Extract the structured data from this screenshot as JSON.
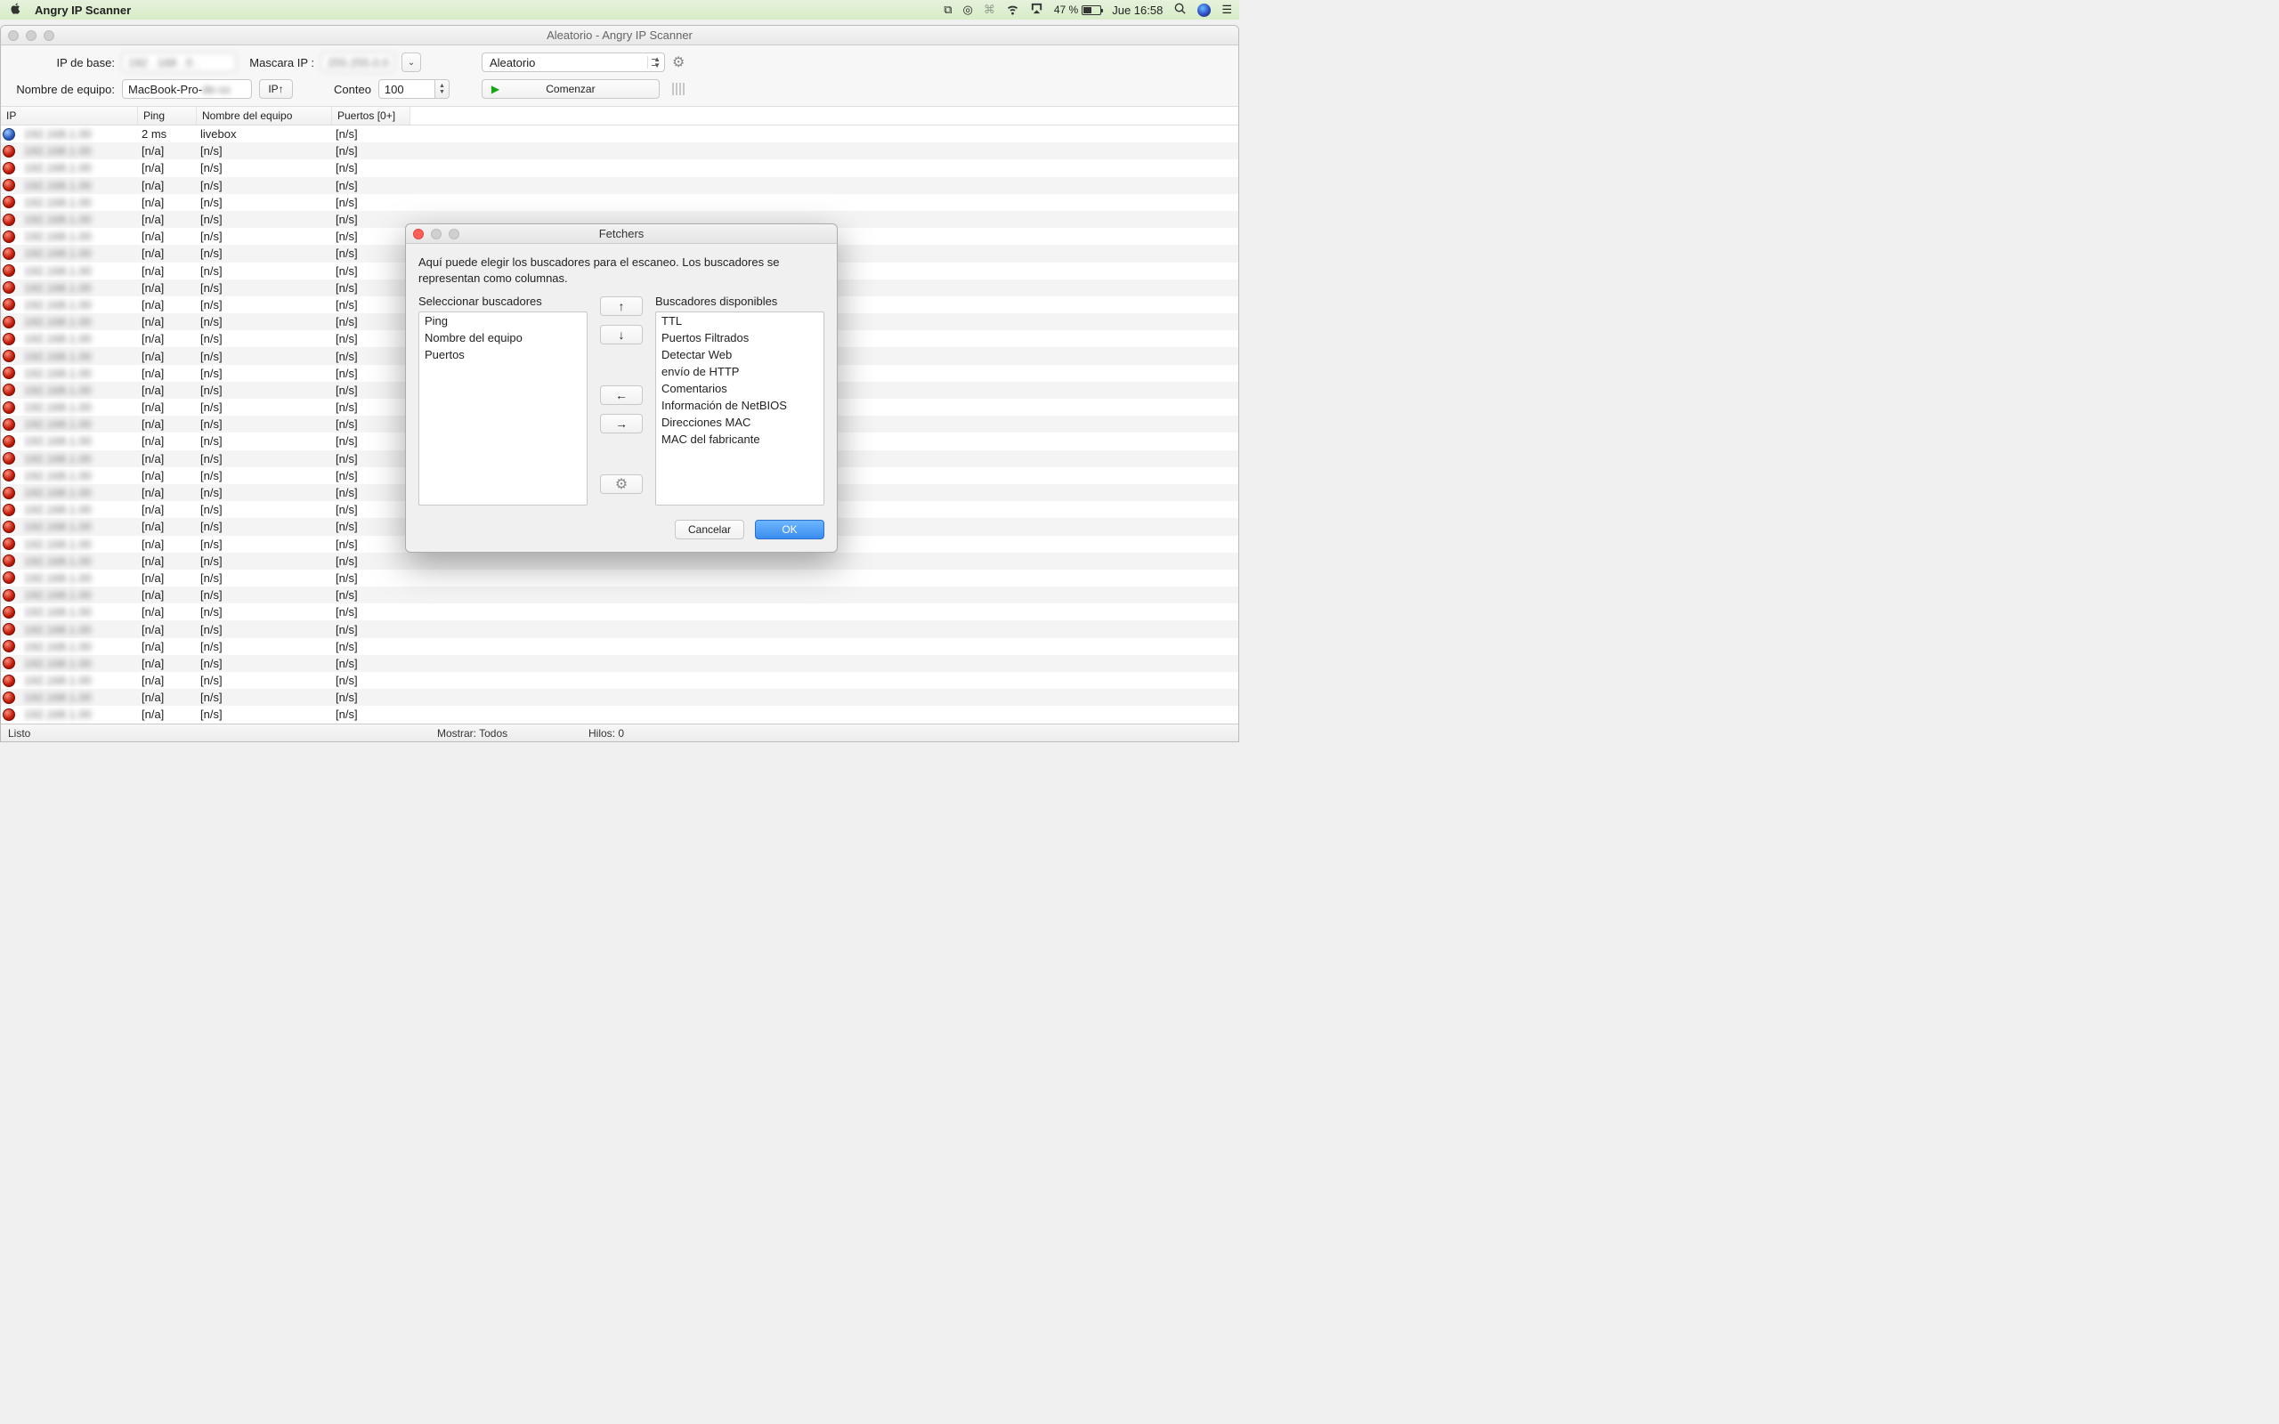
{
  "menubar": {
    "app_name": "Angry IP Scanner",
    "battery_pct": "47 %",
    "clock": "Jue 16:58"
  },
  "window": {
    "title": "Aleatorio - Angry IP Scanner"
  },
  "toolbar": {
    "ip_base_label": "IP de base:",
    "ip_base_value": "192 . 168 .    0 .",
    "mask_label": "Mascara IP :",
    "mask_value": "255.255.0.0",
    "mask_dropdown": "",
    "mode_value": "Aleatorio",
    "hostname_label": "Nombre de equipo:",
    "hostname_value": "MacBook-Pro-",
    "ip_up_btn": "IP↑",
    "count_label": "Conteo",
    "count_value": "100",
    "start_btn": "Comenzar"
  },
  "columns": {
    "ip": "IP",
    "ping": "Ping",
    "host": "Nombre del equipo",
    "ports": "Puertos [0+]"
  },
  "first_row": {
    "ping": "2 ms",
    "host": "livebox",
    "ports": "[n/s]"
  },
  "na": "[n/a]",
  "ns": "[n/s]",
  "dead_row_count": 35,
  "statusbar": {
    "ready": "Listo",
    "show": "Mostrar: Todos",
    "threads": "Hilos: 0"
  },
  "dialog": {
    "title": "Fetchers",
    "desc": "Aquí puede elegir los buscadores para el escaneo. Los buscadores se representan como columnas.",
    "selected_label": "Seleccionar buscadores",
    "available_label": "Buscadores disponibles",
    "selected": [
      "Ping",
      "Nombre del equipo",
      "Puertos"
    ],
    "available": [
      "TTL",
      "Puertos Filtrados",
      "Detectar Web",
      "envío de HTTP",
      "Comentarios",
      "Información de NetBIOS",
      "Direcciones MAC",
      "MAC del fabricante"
    ],
    "btn_up": "↑",
    "btn_down": "↓",
    "btn_left": "←",
    "btn_right": "→",
    "btn_prefs": "⚙",
    "cancel": "Cancelar",
    "ok": "OK"
  }
}
